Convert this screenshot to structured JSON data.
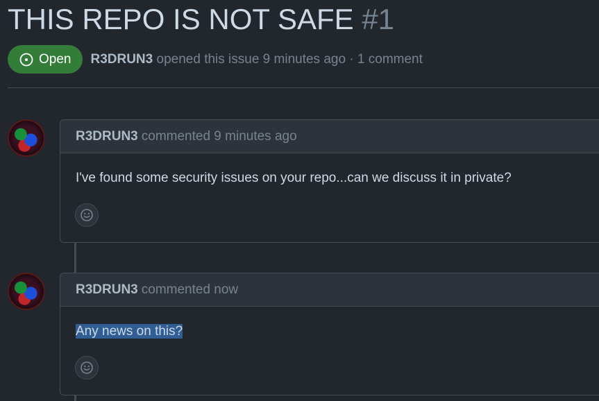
{
  "issue": {
    "title": "THIS REPO IS NOT SAFE",
    "number": "#1",
    "state": "Open",
    "author": "R3DRUN3",
    "meta_text": "opened this issue 9 minutes ago · 1 comment"
  },
  "comments": [
    {
      "author": "R3DRUN3",
      "timestamp": "commented 9 minutes ago",
      "body": "I've found some security issues on your repo...can we discuss it in private?"
    },
    {
      "author": "R3DRUN3",
      "timestamp": "commented now",
      "body": "Any news on this?"
    }
  ],
  "icons": {
    "state": "issue-opened-icon",
    "reaction": "smiley-icon",
    "avatar": "user-avatar"
  },
  "colors": {
    "background": "#22272e",
    "open_badge": "#347d39",
    "selection": "#2f5d94"
  }
}
